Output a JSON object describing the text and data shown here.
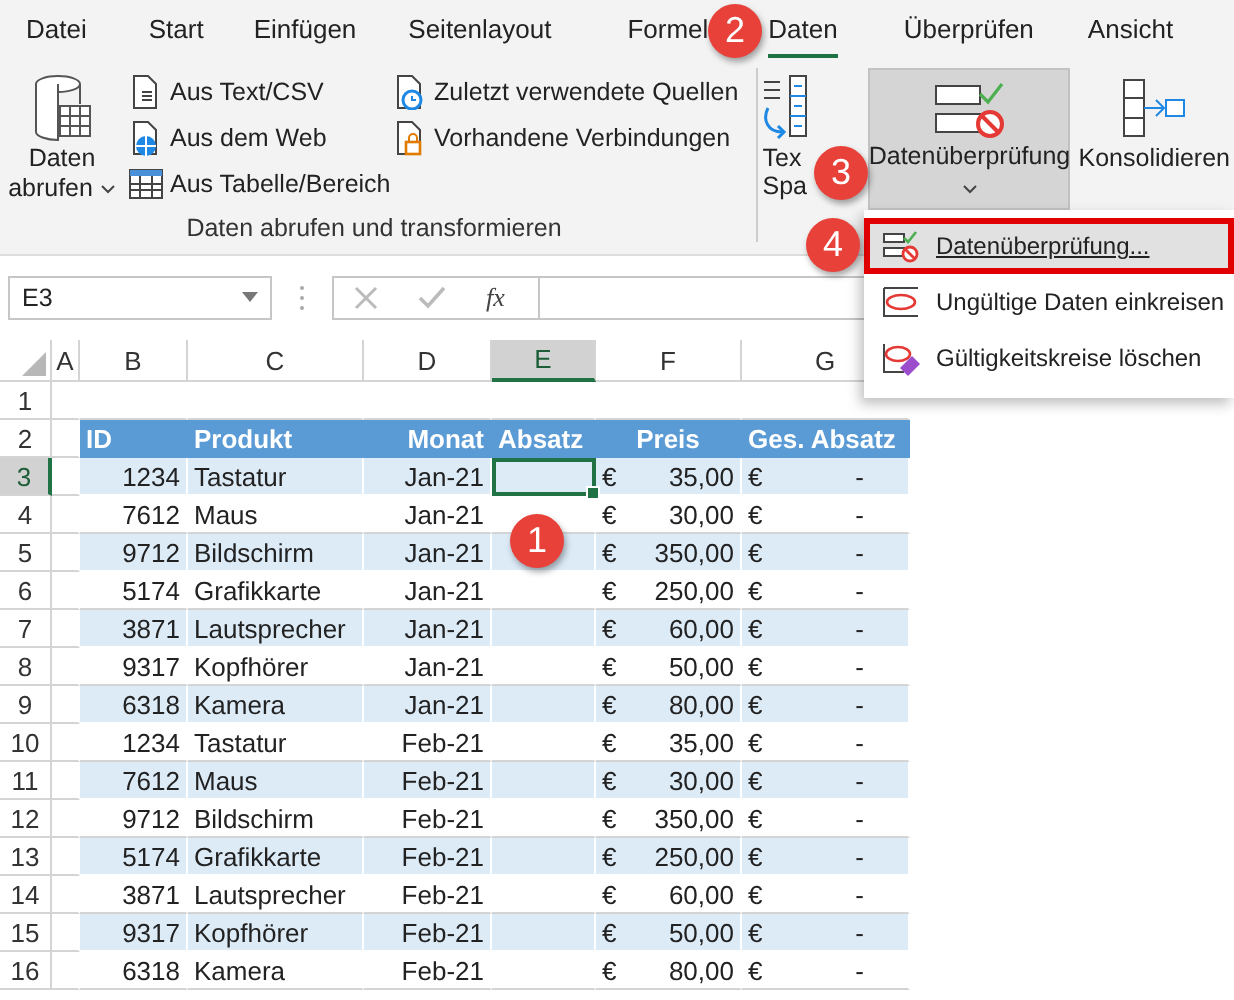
{
  "tabs": [
    {
      "label": "Datei",
      "selected": false
    },
    {
      "label": "Start",
      "selected": false
    },
    {
      "label": "Einfügen",
      "selected": false
    },
    {
      "label": "Seitenlayout",
      "selected": false
    },
    {
      "label": "Formel",
      "selected": false
    },
    {
      "label": "Daten",
      "selected": true
    },
    {
      "label": "Überprüfen",
      "selected": false
    },
    {
      "label": "Ansicht",
      "selected": false
    }
  ],
  "ribbon": {
    "get_data": {
      "lines": [
        "Daten",
        "abrufen"
      ]
    },
    "small_buttons": [
      {
        "kind": "text-file",
        "label": "Aus Text/CSV"
      },
      {
        "kind": "web",
        "label": "Aus dem Web"
      },
      {
        "kind": "table",
        "label": "Aus Tabelle/Bereich"
      },
      {
        "kind": "recent",
        "label": "Zuletzt verwendete Quellen"
      },
      {
        "kind": "connection",
        "label": "Vorhandene Verbindungen"
      }
    ],
    "group_label": "Daten abrufen und transformieren",
    "text_to_columns": {
      "lines": [
        "Tex",
        "Spa"
      ]
    },
    "data_validation": {
      "label": "Datenüberprüfung",
      "selected": true
    },
    "consolidate": {
      "label": "Konsolidieren"
    }
  },
  "name_box": "E3",
  "formula_function": "fx",
  "table": {
    "columns": [
      {
        "label": "A",
        "selected": false
      },
      {
        "label": "B",
        "selected": false
      },
      {
        "label": "C",
        "selected": false
      },
      {
        "label": "D",
        "selected": false
      },
      {
        "label": "E",
        "selected": true
      },
      {
        "label": "F",
        "selected": false
      },
      {
        "label": "G",
        "selected": false
      }
    ],
    "rows": [
      {
        "number": "1",
        "selected": false,
        "cells": []
      },
      {
        "number": "2",
        "selected": false,
        "kind": "header",
        "cells": [
          "",
          "ID",
          "Produkt",
          "Monat",
          "Absatz",
          "Preis",
          "Ges. Absatz"
        ]
      },
      {
        "number": "3",
        "selected": true,
        "cells": [
          "",
          "1234",
          "Tastatur",
          "Jan-21",
          "",
          {
            "currency": "€",
            "amount": "35,00"
          },
          {
            "currency": "€",
            "amount": "-"
          }
        ]
      },
      {
        "number": "4",
        "selected": false,
        "cells": [
          "",
          "7612",
          "Maus",
          "Jan-21",
          "",
          {
            "currency": "€",
            "amount": "30,00"
          },
          {
            "currency": "€",
            "amount": "-"
          }
        ]
      },
      {
        "number": "5",
        "selected": false,
        "cells": [
          "",
          "9712",
          "Bildschirm",
          "Jan-21",
          "",
          {
            "currency": "€",
            "amount": "350,00"
          },
          {
            "currency": "€",
            "amount": "-"
          }
        ]
      },
      {
        "number": "6",
        "selected": false,
        "cells": [
          "",
          "5174",
          "Grafikkarte",
          "Jan-21",
          "",
          {
            "currency": "€",
            "amount": "250,00"
          },
          {
            "currency": "€",
            "amount": "-"
          }
        ]
      },
      {
        "number": "7",
        "selected": false,
        "cells": [
          "",
          "3871",
          "Lautsprecher",
          "Jan-21",
          "",
          {
            "currency": "€",
            "amount": "60,00"
          },
          {
            "currency": "€",
            "amount": "-"
          }
        ]
      },
      {
        "number": "8",
        "selected": false,
        "cells": [
          "",
          "9317",
          "Kopfhörer",
          "Jan-21",
          "",
          {
            "currency": "€",
            "amount": "50,00"
          },
          {
            "currency": "€",
            "amount": "-"
          }
        ]
      },
      {
        "number": "9",
        "selected": false,
        "cells": [
          "",
          "6318",
          "Kamera",
          "Jan-21",
          "",
          {
            "currency": "€",
            "amount": "80,00"
          },
          {
            "currency": "€",
            "amount": "-"
          }
        ]
      },
      {
        "number": "10",
        "selected": false,
        "cells": [
          "",
          "1234",
          "Tastatur",
          "Feb-21",
          "",
          {
            "currency": "€",
            "amount": "35,00"
          },
          {
            "currency": "€",
            "amount": "-"
          }
        ]
      },
      {
        "number": "11",
        "selected": false,
        "cells": [
          "",
          "7612",
          "Maus",
          "Feb-21",
          "",
          {
            "currency": "€",
            "amount": "30,00"
          },
          {
            "currency": "€",
            "amount": "-"
          }
        ]
      },
      {
        "number": "12",
        "selected": false,
        "cells": [
          "",
          "9712",
          "Bildschirm",
          "Feb-21",
          "",
          {
            "currency": "€",
            "amount": "350,00"
          },
          {
            "currency": "€",
            "amount": "-"
          }
        ]
      },
      {
        "number": "13",
        "selected": false,
        "cells": [
          "",
          "5174",
          "Grafikkarte",
          "Feb-21",
          "",
          {
            "currency": "€",
            "amount": "250,00"
          },
          {
            "currency": "€",
            "amount": "-"
          }
        ]
      },
      {
        "number": "14",
        "selected": false,
        "cells": [
          "",
          "3871",
          "Lautsprecher",
          "Feb-21",
          "",
          {
            "currency": "€",
            "amount": "60,00"
          },
          {
            "currency": "€",
            "amount": "-"
          }
        ]
      },
      {
        "number": "15",
        "selected": false,
        "cells": [
          "",
          "9317",
          "Kopfhörer",
          "Feb-21",
          "",
          {
            "currency": "€",
            "amount": "50,00"
          },
          {
            "currency": "€",
            "amount": "-"
          }
        ]
      },
      {
        "number": "16",
        "selected": false,
        "cells": [
          "",
          "6318",
          "Kamera",
          "Feb-21",
          "",
          {
            "currency": "€",
            "amount": "80,00"
          },
          {
            "currency": "€",
            "amount": "-"
          }
        ]
      }
    ]
  },
  "dropdown_menu": [
    {
      "kind": "validate",
      "label": "Datenüberprüfung...",
      "selected": true
    },
    {
      "kind": "circle",
      "label": "Ungültige Daten einkreisen",
      "selected": false
    },
    {
      "kind": "erase",
      "label": "Gültigkeitskreise löschen",
      "selected": false
    }
  ],
  "callouts": [
    {
      "label": "1"
    },
    {
      "label": "2"
    },
    {
      "label": "3"
    },
    {
      "label": "4"
    }
  ]
}
